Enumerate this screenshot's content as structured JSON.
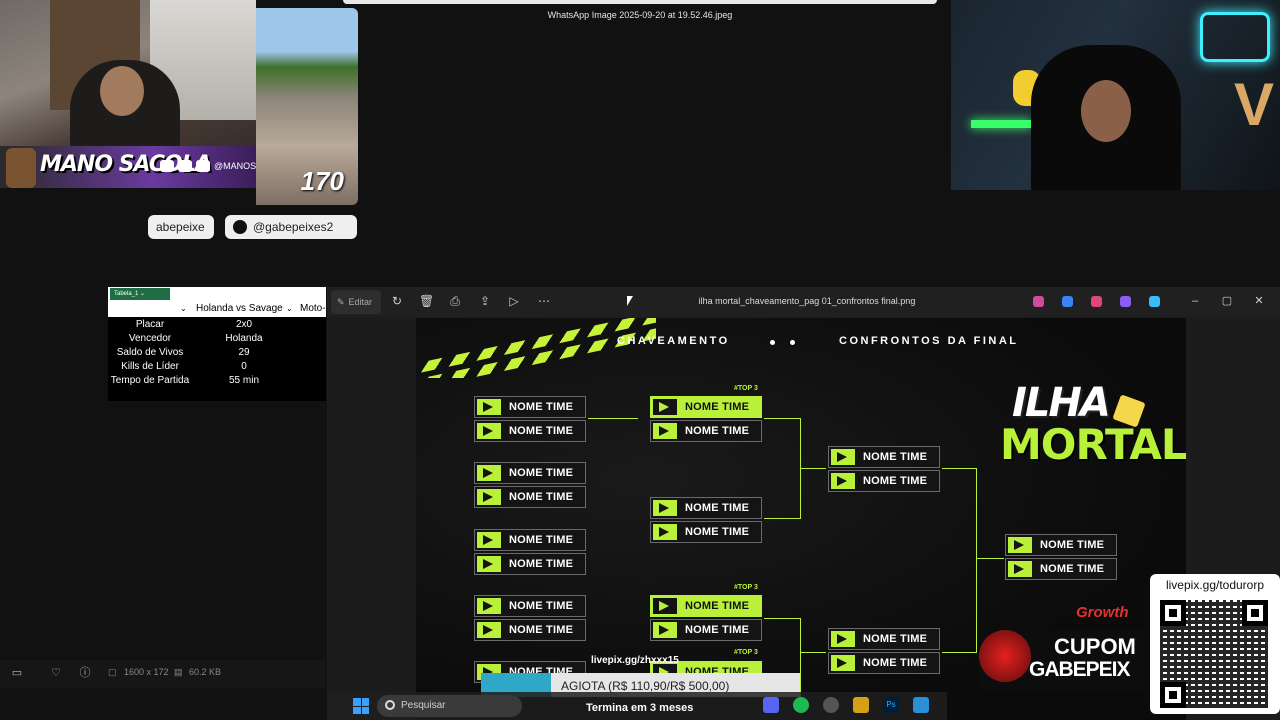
{
  "viewer_title": "WhatsApp Image 2025-09-20 at 19.52.46.jpeg",
  "webcam_left": {
    "streamer_name": "MANO SACOLA",
    "social_handle": "@MANOSACOLA",
    "viewer_count": "170"
  },
  "social_pills": [
    {
      "label": "abepeixe"
    },
    {
      "label": "@gabepeixes2"
    }
  ],
  "spreadsheet": {
    "tab_label": "Tabela_1",
    "header": [
      "Holanda vs Savage",
      "Moto-"
    ],
    "rows": [
      {
        "key": "Placar",
        "value": "2x0"
      },
      {
        "key": "Vencedor",
        "value": "Holanda"
      },
      {
        "key": "Saldo de Vivos",
        "value": "29"
      },
      {
        "key": "Kills de Líder",
        "value": "0"
      },
      {
        "key": "Tempo de Partida",
        "value": "55 min"
      }
    ]
  },
  "photos": {
    "edit_label": "Editar",
    "file_title": "ilha mortal_chaveamento_pag 01_confrontos final.png",
    "toolbar_icons": [
      "rotate-icon",
      "delete-icon",
      "print-icon",
      "share-icon",
      "slideshow-icon",
      "more-icon"
    ]
  },
  "bracket": {
    "heading_left": "CHAVEAMENTO",
    "heading_right": "CONFRONTOS DA FINAL",
    "team_label": "NOME TIME",
    "top3_label": "#TOP 3",
    "logo_line1": "ILHA",
    "logo_line2": "MORTAL",
    "accent_color": "#b8f03a"
  },
  "status_bar": {
    "dimensions": "1600 x 172",
    "file_size": "60.2 KB"
  },
  "donation": {
    "url": "livepix.gg/zhxxx15",
    "goal_text": "AGIOTA (R$ 110,90/R$ 500,00)",
    "goal_progress": 0.22,
    "time_left": "Termina em 3 meses"
  },
  "taskbar": {
    "search_placeholder": "Pesquisar"
  },
  "promo": {
    "brand": "Growth",
    "line1": "CUPOM",
    "line2": "GABEPEIX"
  },
  "qr": {
    "label": "livepix.gg/todurorp"
  }
}
